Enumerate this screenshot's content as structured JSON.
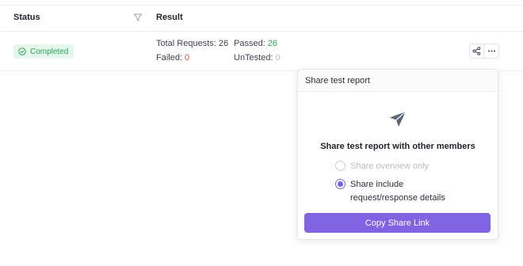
{
  "table": {
    "columns": {
      "status": "Status",
      "result": "Result"
    },
    "row": {
      "status_badge": "Completed",
      "total_requests_label": "Total Requests:",
      "total_requests_value": "26",
      "passed_label": "Passed:",
      "passed_value": "26",
      "failed_label": "Failed:",
      "failed_value": "0",
      "untested_label": "UnTested:",
      "untested_value": "0"
    }
  },
  "share_popover": {
    "header": "Share test report",
    "title": "Share test report with other members",
    "options": [
      {
        "label": "Share overview only",
        "selected": false,
        "disabled": true
      },
      {
        "label": "Share include request/response details",
        "selected": true,
        "disabled": false
      }
    ],
    "copy_button": "Copy Share Link"
  },
  "colors": {
    "accent": "#7f63e3",
    "success": "#29a35a",
    "success_bg": "#e5f6ec",
    "danger": "#e5484d"
  },
  "icons": [
    "filter-icon",
    "check-circle-icon",
    "share-icon",
    "more-icon",
    "paper-plane-icon"
  ]
}
